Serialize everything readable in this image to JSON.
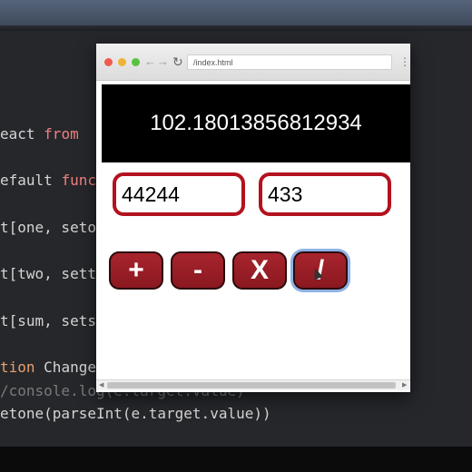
{
  "code": {
    "lines": [
      {
        "pre": "eact ",
        "kw": "from",
        "post": ""
      },
      {
        "pre": "efault ",
        "kw": "func",
        "post": ""
      },
      {
        "pre": "t[one, set",
        "kw": "",
        "post": "o"
      },
      {
        "pre": "t[two, set",
        "kw": "",
        "post": "t"
      },
      {
        "pre": "t[sum, set",
        "kw": "",
        "post": "s"
      },
      {
        "pre": "",
        "kw": "tion ",
        "post": "Change"
      },
      {
        "comment": "/console.log(e.target.value)"
      },
      {
        "pre": "etone(parseInt(e.target.value))",
        "kw": "",
        "post": ""
      }
    ]
  },
  "browser": {
    "url": "/index.html",
    "back_icon": "arrow-left-icon",
    "forward_icon": "arrow-right-icon",
    "reload_icon": "reload-icon",
    "menu_icon": "kebab-menu-icon"
  },
  "app": {
    "result": "102.18013856812934",
    "input_one": "44244",
    "input_two": "433",
    "buttons": {
      "add": "+",
      "subtract": "-",
      "multiply": "X",
      "divide": "/"
    }
  },
  "colors": {
    "accent": "#b3121e",
    "button": "#a8242d",
    "display_bg": "#000000",
    "focus_ring": "#8fb2e6"
  }
}
